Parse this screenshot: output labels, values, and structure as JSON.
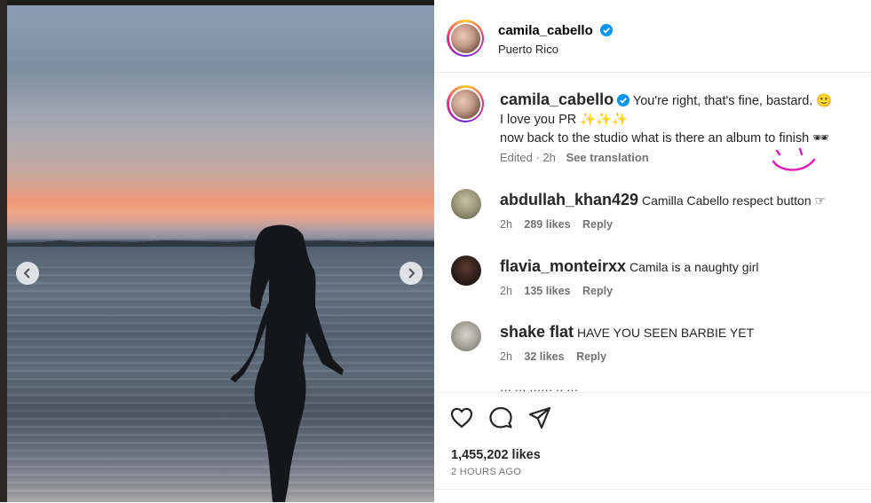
{
  "header": {
    "username": "camila_cabello",
    "location": "Puerto Rico"
  },
  "caption": {
    "username": "camila_cabello",
    "line1": "You're right, that's fine, bastard. 🙂",
    "line2": "I love you PR ✨✨✨",
    "line3": "now back to the studio what is there an album to finish 🕶",
    "edited": "Edited · 2h",
    "see_translation": "See translation"
  },
  "comments": [
    {
      "username": "abdullah_khan429",
      "text": "Camilla Cabello respect button ☞",
      "time": "2h",
      "likes": "289 likes",
      "reply": "Reply"
    },
    {
      "username": "flavia_monteirxx",
      "text": "Camila is a naughty girl",
      "time": "2h",
      "likes": "135 likes",
      "reply": "Reply"
    },
    {
      "username": "shake flat",
      "text": "HAVE YOU SEEN BARBIE YET",
      "time": "2h",
      "likes": "32 likes",
      "reply": "Reply"
    }
  ],
  "partial_comment": "··· ··· ······ ·· ···",
  "likes": "1,455,202 likes",
  "time_ago": "2 HOURS AGO",
  "colors": {
    "verified": "#0095f6",
    "smiley": "#e01fb8"
  },
  "icons": [
    "chevron-left-icon",
    "chevron-right-icon",
    "verified-icon",
    "heart-icon",
    "comment-icon",
    "share-icon"
  ]
}
